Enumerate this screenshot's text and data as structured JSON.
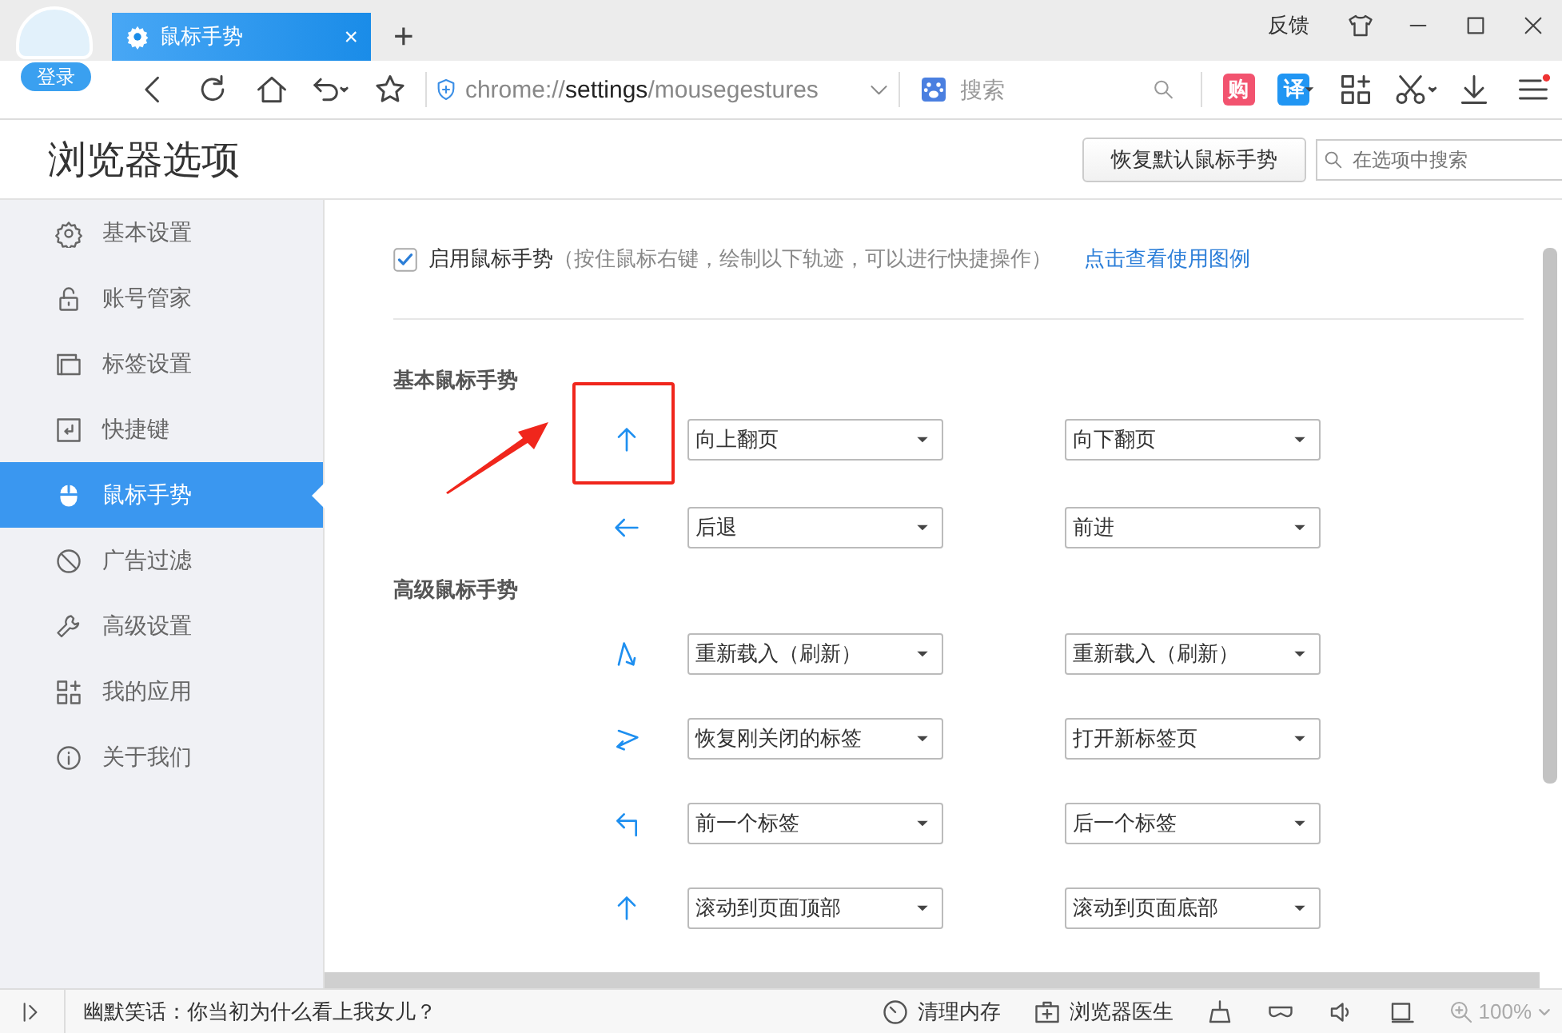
{
  "account": {
    "login": "登录"
  },
  "tab": {
    "title": "鼠标手势",
    "close": "×"
  },
  "new_tab": "+",
  "feedback": "反馈",
  "address_bar": {
    "scheme": "chrome://",
    "host": "settings",
    "path": "/mousegestures"
  },
  "search_box": {
    "placeholder": "搜索"
  },
  "extensions": [
    {
      "label": "购",
      "color": "#f2536f"
    },
    {
      "label": "译",
      "color": "#2196f3"
    }
  ],
  "page_title": "浏览器选项",
  "restore_button": "恢复默认鼠标手势",
  "settings_search": {
    "placeholder": "在选项中搜索"
  },
  "sidebar": {
    "items": [
      {
        "kind": "gear",
        "label": "基本设置",
        "selected": false
      },
      {
        "kind": "lock",
        "label": "账号管家",
        "selected": false
      },
      {
        "kind": "tabs",
        "label": "标签设置",
        "selected": false
      },
      {
        "kind": "key",
        "label": "快捷键",
        "selected": false
      },
      {
        "kind": "mouse",
        "label": "鼠标手势",
        "selected": true
      },
      {
        "kind": "ban",
        "label": "广告过滤",
        "selected": false
      },
      {
        "kind": "wrench",
        "label": "高级设置",
        "selected": false
      },
      {
        "kind": "apps",
        "label": "我的应用",
        "selected": false
      },
      {
        "kind": "info",
        "label": "关于我们",
        "selected": false
      }
    ]
  },
  "enable": {
    "checked": true,
    "label": "启用鼠标手势",
    "hint": "（按住鼠标右键，绘制以下轨迹，可以进行快捷操作）",
    "link": "点击查看使用图例"
  },
  "sections": [
    {
      "title": "基本鼠标手势",
      "gestures": [
        {
          "kind": "up",
          "action": "向上翻页",
          "highlighted": true
        },
        {
          "kind": "down",
          "action": "向下翻页",
          "highlighted": false
        },
        {
          "kind": "left",
          "action": "后退",
          "highlighted": false
        },
        {
          "kind": "right",
          "action": "前进",
          "highlighted": false
        }
      ]
    },
    {
      "title": "高级鼠标手势",
      "gestures": [
        {
          "kind": "up-down",
          "action": "重新载入（刷新）",
          "highlighted": false
        },
        {
          "kind": "down-up",
          "action": "重新载入（刷新）",
          "highlighted": false
        },
        {
          "kind": "right-left",
          "action": "恢复刚关闭的标签",
          "highlighted": false
        },
        {
          "kind": "left-right",
          "action": "打开新标签页",
          "highlighted": false
        },
        {
          "kind": "up-left",
          "action": "前一个标签",
          "highlighted": false
        },
        {
          "kind": "up-right",
          "action": "后一个标签",
          "highlighted": false
        },
        {
          "kind": "up",
          "action": "滚动到页面顶部",
          "highlighted": false
        },
        {
          "kind": "right-down",
          "action": "滚动到页面底部",
          "highlighted": false
        }
      ]
    }
  ],
  "status_bar": {
    "message": "幽默笑话：你当初为什么看上我女儿？",
    "clean_memory": "清理内存",
    "doctor": "浏览器医生",
    "zoom": "100%"
  }
}
